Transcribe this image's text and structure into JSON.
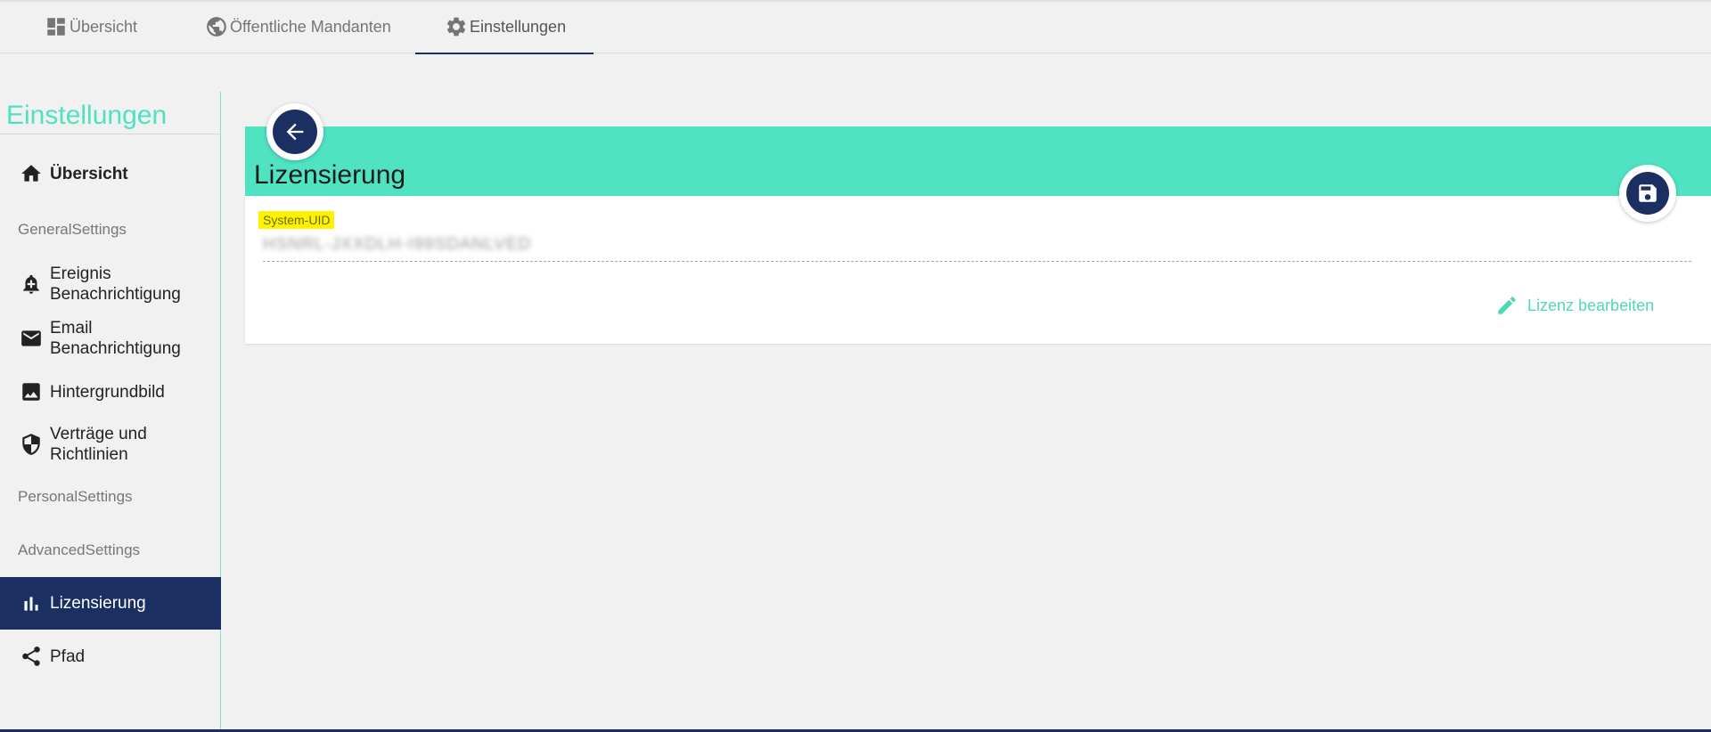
{
  "tabs": [
    {
      "label": "Übersicht",
      "icon": "dashboard-icon"
    },
    {
      "label": "Öffentliche Mandanten",
      "icon": "globe-icon"
    },
    {
      "label": "Einstellungen",
      "icon": "gear-icon",
      "active": true
    }
  ],
  "sidebar": {
    "title": "Einstellungen",
    "overview": {
      "label": "Übersicht",
      "icon": "home-icon"
    },
    "sections": {
      "general": "GeneralSettings",
      "personal": "PersonalSettings",
      "advanced": "AdvancedSettings"
    },
    "items": {
      "ereignis": {
        "line1": "Ereignis",
        "line2": "Benachrichtigung",
        "icon": "bell-plus-icon"
      },
      "email": {
        "line1": "Email",
        "line2": "Benachrichtigung",
        "icon": "mail-icon"
      },
      "hintergrund": {
        "label": "Hintergrundbild",
        "icon": "image-icon"
      },
      "vertraege": {
        "line1": "Verträge und",
        "line2": "Richtlinien",
        "icon": "shield-icon"
      },
      "lizensierung": {
        "label": "Lizensierung",
        "icon": "bar-chart-icon",
        "active": true
      },
      "pfad": {
        "label": "Pfad",
        "icon": "share-icon"
      }
    }
  },
  "main": {
    "title": "Lizensierung",
    "field": {
      "label": "System-UID",
      "value": "HSNRL-JXXDLH-I99SDANLVED"
    },
    "edit_label": "Lizenz bearbeiten"
  },
  "colors": {
    "accent": "#50e3c2",
    "primary": "#1c2f63",
    "highlight": "#fff200"
  }
}
